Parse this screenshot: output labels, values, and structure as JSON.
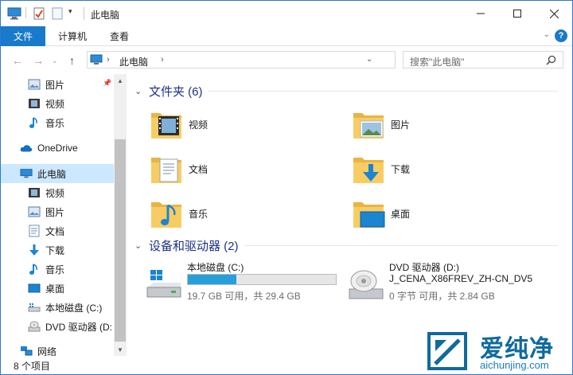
{
  "window": {
    "title": "此电脑"
  },
  "ribbon": {
    "tabs": [
      "文件",
      "计算机",
      "查看"
    ]
  },
  "address": {
    "path": "此电脑"
  },
  "search": {
    "placeholder": "搜索\"此电脑\""
  },
  "sidebar": {
    "items": [
      {
        "label": "图片",
        "icon": "pictures-icon",
        "pinned": true
      },
      {
        "label": "视频",
        "icon": "videos-icon"
      },
      {
        "label": "音乐",
        "icon": "music-icon"
      },
      {
        "label": "OneDrive",
        "icon": "onedrive-icon"
      },
      {
        "label": "此电脑",
        "icon": "this-pc-icon",
        "selected": true
      },
      {
        "label": "视频",
        "icon": "videos-icon"
      },
      {
        "label": "图片",
        "icon": "pictures-icon"
      },
      {
        "label": "文档",
        "icon": "documents-icon"
      },
      {
        "label": "下载",
        "icon": "downloads-icon"
      },
      {
        "label": "音乐",
        "icon": "music-icon"
      },
      {
        "label": "桌面",
        "icon": "desktop-icon"
      },
      {
        "label": "本地磁盘 (C:)",
        "icon": "drive-c-icon"
      },
      {
        "label": "DVD 驱动器 (D:",
        "icon": "dvd-drive-icon"
      },
      {
        "label": "网络",
        "icon": "network-icon"
      }
    ]
  },
  "main": {
    "folders_header": "文件夹 (6)",
    "folders": [
      {
        "label": "视频",
        "icon": "videos-folder-icon"
      },
      {
        "label": "图片",
        "icon": "pictures-folder-icon"
      },
      {
        "label": "文档",
        "icon": "documents-folder-icon"
      },
      {
        "label": "下载",
        "icon": "downloads-folder-icon"
      },
      {
        "label": "音乐",
        "icon": "music-folder-icon"
      },
      {
        "label": "桌面",
        "icon": "desktop-folder-icon"
      }
    ],
    "devices_header": "设备和驱动器 (2)",
    "drives": [
      {
        "name": "本地磁盘 (C:)",
        "size_text": "19.7 GB 可用，共 29.4 GB",
        "used_fraction": 0.33
      },
      {
        "name": "DVD 驱动器 (D:)",
        "label": "J_CENA_X86FREV_ZH-CN_DV5",
        "size_text": "0 字节 可用，共 2.84 GB"
      }
    ]
  },
  "status": {
    "text": "8 个项目"
  },
  "watermark": {
    "brand": "爱纯净",
    "url": "aichunjing.com"
  },
  "colors": {
    "accent": "#1979ca",
    "header": "#1e3287",
    "selected": "#cce8ff",
    "bar": "#26a0da",
    "folder": "#f1c25b"
  }
}
